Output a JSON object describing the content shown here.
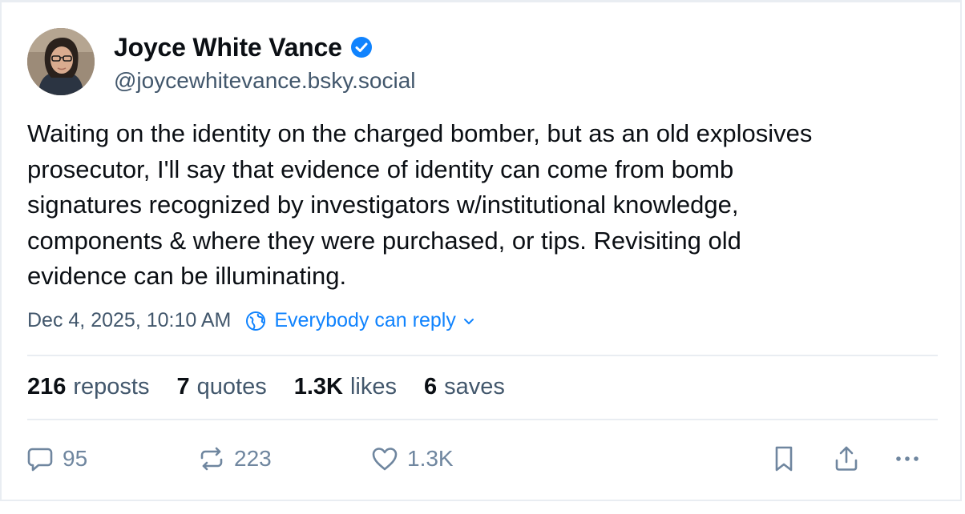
{
  "author": {
    "display_name": "Joyce White Vance",
    "handle": "@joycewhitevance.bsky.social",
    "verified_icon": "verified-badge-icon",
    "avatar_icon": "avatar-photo"
  },
  "post": {
    "text": "Waiting on the identity on the charged bomber, but as an old explosives\nprosecutor, I'll say that evidence of identity can come from bomb\nsignatures recognized by investigators w/institutional knowledge,\ncomponents & where they were purchased, or tips. Revisiting old\nevidence can be illuminating.",
    "timestamp": "Dec 4, 2025, 10:10 AM",
    "reply_setting": "Everybody can reply"
  },
  "stats": {
    "reposts": {
      "count": "216",
      "label": "reposts"
    },
    "quotes": {
      "count": "7",
      "label": "quotes"
    },
    "likes": {
      "count": "1.3K",
      "label": "likes"
    },
    "saves": {
      "count": "6",
      "label": "saves"
    }
  },
  "actions": {
    "reply_count": "95",
    "repost_count": "223",
    "like_count": "1.3K"
  },
  "colors": {
    "accent": "#1083fe",
    "text": "#0b0f14",
    "muted": "#42576c",
    "icon": "#6f869f",
    "divider": "#e9edf2"
  }
}
